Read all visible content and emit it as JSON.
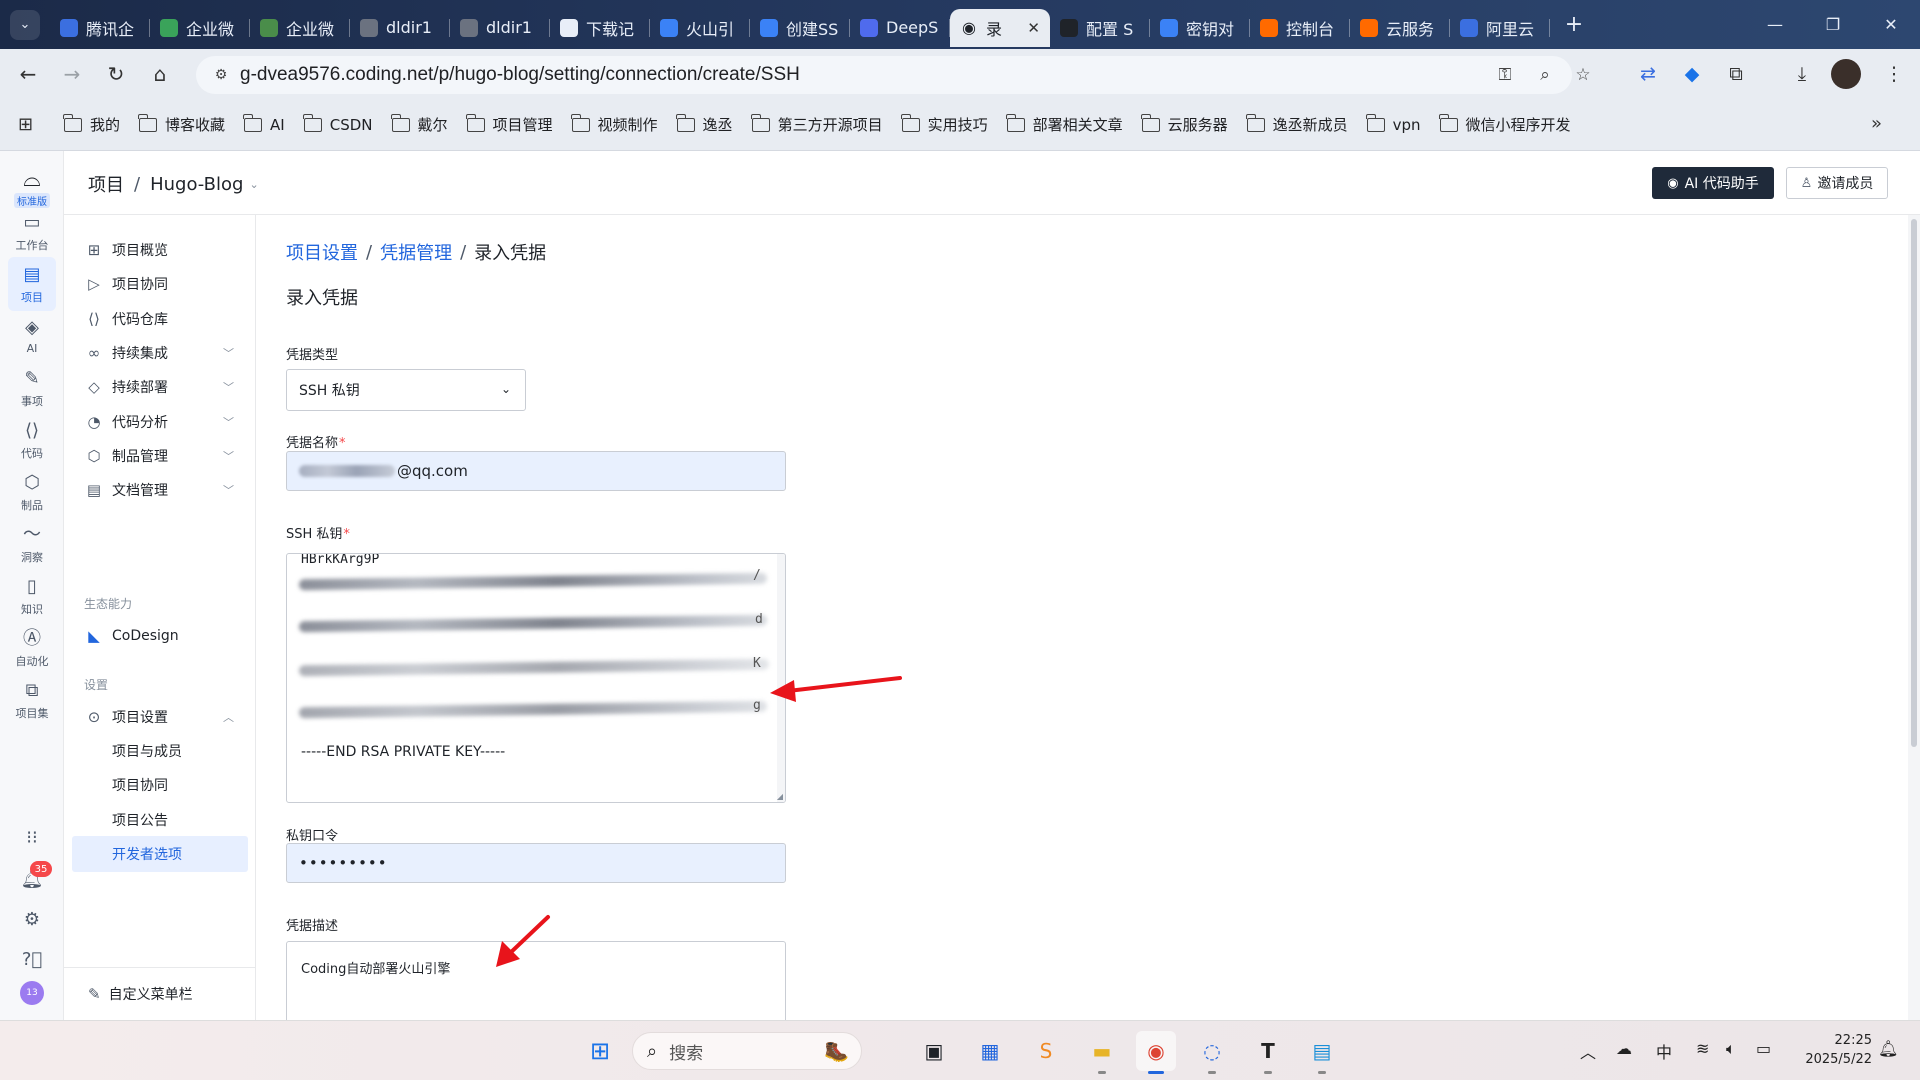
{
  "browser": {
    "tabs": [
      {
        "label": "腾讯企",
        "icon": "tencent-icon",
        "color": "#3b6fe0"
      },
      {
        "label": "企业微",
        "icon": "wechat-work-icon",
        "color": "#3aa35a"
      },
      {
        "label": "企业微",
        "icon": "wechat-work-icon",
        "color": "#4a8d4a"
      },
      {
        "label": "dldir1",
        "icon": "globe-icon",
        "color": "#6b7280"
      },
      {
        "label": "dldir1",
        "icon": "globe-icon",
        "color": "#6b7280"
      },
      {
        "label": "下载记",
        "icon": "download-icon",
        "color": "#e8eef8"
      },
      {
        "label": "火山引",
        "icon": "volcano-icon",
        "color": "#3b82f6"
      },
      {
        "label": "创建SS",
        "icon": "volcano-icon",
        "color": "#3b82f6"
      },
      {
        "label": "DeepS",
        "icon": "deepseek-icon",
        "color": "#4f6bed"
      },
      {
        "label": "录",
        "icon": "coding-icon",
        "color": "#1f2329",
        "active": true
      },
      {
        "label": "配置 S",
        "icon": "coding-icon",
        "color": "#1f2329"
      },
      {
        "label": "密钥对",
        "icon": "volcano-icon",
        "color": "#3b82f6"
      },
      {
        "label": "控制台",
        "icon": "aliyun-icon",
        "color": "#ff6a00"
      },
      {
        "label": "云服务",
        "icon": "aliyun-icon",
        "color": "#ff6a00"
      },
      {
        "label": "阿里云",
        "icon": "baidu-icon",
        "color": "#3b6fe0"
      }
    ],
    "url": "g-dvea9576.coding.net/p/hugo-blog/setting/connection/create/SSH",
    "bookmarks": [
      "我的",
      "博客收藏",
      "AI",
      "CSDN",
      "戴尔",
      "项目管理",
      "视频制作",
      "逸丞",
      "第三方开源项目",
      "实用技巧",
      "部署相关文章",
      "云服务器",
      "逸丞新成员",
      "vpn",
      "微信小程序开发"
    ]
  },
  "rail": {
    "edition_badge": "标准版",
    "items": [
      {
        "label": "工作台",
        "icon": "monitor-icon",
        "glyph": "▭"
      },
      {
        "label": "项目",
        "icon": "project-icon",
        "glyph": "▤",
        "active": true
      },
      {
        "label": "AI",
        "icon": "ai-icon",
        "glyph": "◈"
      },
      {
        "label": "事项",
        "icon": "edit-doc-icon",
        "glyph": "✎"
      },
      {
        "label": "代码",
        "icon": "code-icon",
        "glyph": "⟨⟩"
      },
      {
        "label": "制品",
        "icon": "cube-icon",
        "glyph": "⬡"
      },
      {
        "label": "洞察",
        "icon": "trend-icon",
        "glyph": "〜"
      },
      {
        "label": "知识",
        "icon": "book-icon",
        "glyph": "▯"
      },
      {
        "label": "自动化",
        "icon": "automation-icon",
        "glyph": "Ⓐ"
      },
      {
        "label": "项目集",
        "icon": "stack-icon",
        "glyph": "⧉"
      }
    ],
    "bell_count": "35",
    "avatar_text": "13"
  },
  "topbar": {
    "root": "项目",
    "project": "Hugo-Blog",
    "ai_button": "AI 代码助手",
    "invite_button": "邀请成员"
  },
  "sidenav": {
    "items": [
      {
        "label": "项目概览",
        "icon": "grid-icon",
        "glyph": "⊞",
        "expandable": false
      },
      {
        "label": "项目协同",
        "icon": "play-icon",
        "glyph": "▷",
        "expandable": false
      },
      {
        "label": "代码仓库",
        "icon": "code-icon",
        "glyph": "⟨⟩",
        "expandable": false
      },
      {
        "label": "持续集成",
        "icon": "link-icon",
        "glyph": "∞",
        "expandable": true
      },
      {
        "label": "持续部署",
        "icon": "deploy-icon",
        "glyph": "◇",
        "expandable": true
      },
      {
        "label": "代码分析",
        "icon": "analysis-icon",
        "glyph": "◔",
        "expandable": true
      },
      {
        "label": "制品管理",
        "icon": "cube-icon",
        "glyph": "⬡",
        "expandable": true
      },
      {
        "label": "文档管理",
        "icon": "doc-icon",
        "glyph": "▤",
        "expandable": true
      }
    ],
    "eco_section": "生态能力",
    "codesign": "CoDesign",
    "settings_section": "设置",
    "project_settings": "项目设置",
    "sub_items": [
      "项目与成员",
      "项目协同",
      "项目公告",
      "开发者选项"
    ],
    "active_sub": 3,
    "customize": "自定义菜单栏"
  },
  "main": {
    "breadcrumb": [
      "项目设置",
      "凭据管理",
      "录入凭据"
    ],
    "title": "录入凭据",
    "type_label": "凭据类型",
    "type_value": "SSH 私钥",
    "name_label": "凭据名称",
    "name_value_suffix": "@qq.com",
    "key_label": "SSH 私钥",
    "key_first_line": "HBrkKArg9P",
    "key_tails": [
      "/",
      "d",
      "K",
      "g"
    ],
    "key_end": "-----END RSA PRIVATE KEY-----",
    "passphrase_label": "私钥口令",
    "passphrase_value": "•••••••••",
    "desc_label": "凭据描述",
    "desc_value": "Coding自动部署火山引擎"
  },
  "taskbar": {
    "search_placeholder": "搜索",
    "ime": "中",
    "time": "22:25",
    "date": "2025/5/22"
  },
  "colors": {
    "accent": "#2266dd",
    "annotation_arrow": "#e8141b",
    "required": "#f5484a"
  }
}
